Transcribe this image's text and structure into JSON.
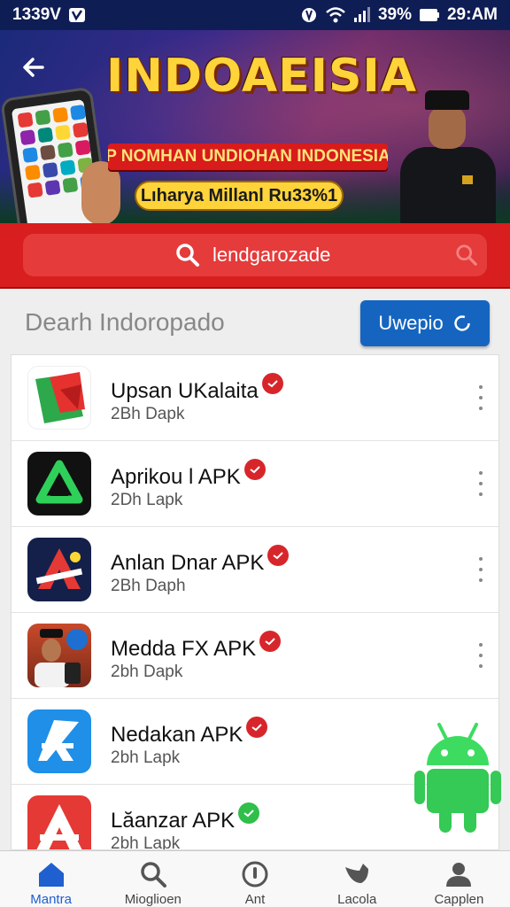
{
  "status_bar": {
    "left_text": "1339V",
    "battery": "39%",
    "time": "29:AM"
  },
  "banner": {
    "title": "INDOAEISIA",
    "subtitle": "P NOMHAN UNDIOHAN INDONESIA",
    "tagline": "Lıharya Millanl Ru33%1"
  },
  "search": {
    "value": "lendgarozade"
  },
  "section": {
    "title": "Dearh Indoropado",
    "button_label": "Uwepio"
  },
  "apps": [
    {
      "name": "Upsan UKalaita",
      "meta": "2Bh Dapk",
      "badge": "red",
      "icon": "red-green-app-icon"
    },
    {
      "name": "Aprikou l APK",
      "meta": "2Dh Lapk",
      "badge": "red",
      "icon": "green-triangle-app-icon"
    },
    {
      "name": "Anlan Dnar APK",
      "meta": "2Bh Daph",
      "badge": "red",
      "icon": "red-a-navy-app-icon"
    },
    {
      "name": "Medda FX APK",
      "meta": "2bh Dapk",
      "badge": "red",
      "icon": "officer-photo-app-icon"
    },
    {
      "name": "Nedakan APK",
      "meta": "2bh Lapk",
      "badge": "red",
      "icon": "blue-a-app-icon"
    },
    {
      "name": "Lăanzar APK",
      "meta": "2bh Lapk",
      "badge": "green",
      "icon": "red-a-app-icon"
    }
  ],
  "colors": {
    "accent_red": "#d81e1e",
    "button_blue": "#1565c0",
    "nav_active": "#1f5fd0",
    "badge_red": "#d7262b",
    "badge_green": "#2fbf4a"
  },
  "bottom_nav": [
    {
      "label": "Mantra",
      "icon": "home-icon",
      "active": true
    },
    {
      "label": "Mioglioen",
      "icon": "search-icon",
      "active": false
    },
    {
      "label": "Ant",
      "icon": "info-icon",
      "active": false
    },
    {
      "label": "Lacola",
      "icon": "bird-icon",
      "active": false
    },
    {
      "label": "Capplen",
      "icon": "profile-icon",
      "active": false
    }
  ]
}
